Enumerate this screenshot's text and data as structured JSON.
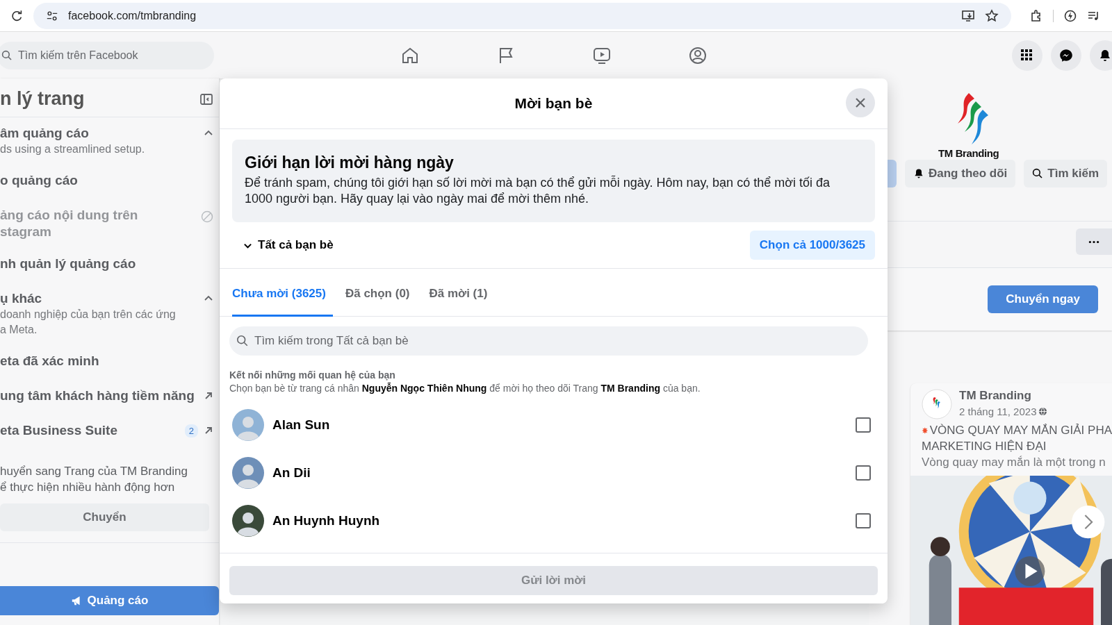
{
  "browser": {
    "url": "facebook.com/tmbranding"
  },
  "topnav": {
    "search_placeholder": "Tìm kiếm trên Facebook"
  },
  "sidebar": {
    "title": "n lý trang",
    "items": [
      {
        "kind": "section",
        "label": "âm quảng cáo",
        "description": [
          "ds using a streamlined setup."
        ],
        "expanded": true,
        "disabled": false
      },
      {
        "kind": "link",
        "label": "o quảng cáo",
        "disabled": false
      },
      {
        "kind": "link",
        "label": "ảng cáo nội dung trên",
        "label_2": "stagram",
        "disabled": true
      },
      {
        "kind": "link",
        "label": "nh quản lý quảng cáo",
        "disabled": false
      },
      {
        "kind": "section",
        "label": "ụ khác",
        "description": [
          "doanh nghiệp của bạn trên các ứng",
          "a Meta."
        ],
        "expanded": true,
        "disabled": false
      },
      {
        "kind": "link",
        "label": "eta đã xác minh",
        "disabled": false
      },
      {
        "kind": "external_link",
        "label": "ung tâm khách hàng tiềm năng",
        "disabled": false
      },
      {
        "kind": "external_link",
        "label": "eta Business Suite",
        "badge": "2",
        "disabled": false
      }
    ],
    "switch_text": [
      "huyển sang Trang của TM Branding",
      "ể thực hiện nhiều hành động hơn"
    ],
    "switch_button": "Chuyển",
    "ads_button": "Quảng cáo"
  },
  "page": {
    "logo_caption": "TM Branding",
    "follow_button": "Đang theo dõi",
    "search_button": "Tìm kiếm",
    "switch_button": "Chuyển ngay",
    "post": {
      "author": "TM Branding",
      "date": "2 tháng 11, 2023",
      "title_lines": [
        "VÒNG QUAY MAY MẮN GIẢI PHA",
        "MARKETING HIỆN ĐẠI"
      ],
      "text": "Vòng quay may mắn là một trong n"
    }
  },
  "dialog": {
    "title": "Mời bạn bè",
    "notice": {
      "title": "Giới hạn lời mời hàng ngày",
      "text": "Để tránh spam, chúng tôi giới hạn số lời mời mà bạn có thể gửi mỗi ngày. Hôm nay, bạn có thể mời tối đa 1000 người bạn. Hãy quay lại vào ngày mai để mời thêm nhé."
    },
    "filter": "Tất cả bạn bè",
    "select_all_button": "Chọn cả 1000/3625",
    "tabs": [
      {
        "label": "Chưa mời (3625)",
        "selected": true
      },
      {
        "label": "Đã chọn (0)",
        "selected": false
      },
      {
        "label": "Đã mời (1)",
        "selected": false
      }
    ],
    "search": {
      "placeholder": "Tìm kiếm trong Tất cả bạn bè"
    },
    "connect": {
      "title": "Kết nối những mối quan hệ của bạn",
      "text": "Chọn bạn bè từ trang cá nhân **Nguyễn Ngọc Thiên Nhung** để mời họ theo dõi Trang **TM Branding** của bạn."
    },
    "friends": [
      {
        "name": "Alan Sun",
        "checked": false
      },
      {
        "name": "An Dii",
        "checked": false
      },
      {
        "name": "An Huynh Huynh",
        "checked": false
      }
    ],
    "send_button": {
      "label": "Gửi lời mời",
      "disabled": true
    }
  }
}
